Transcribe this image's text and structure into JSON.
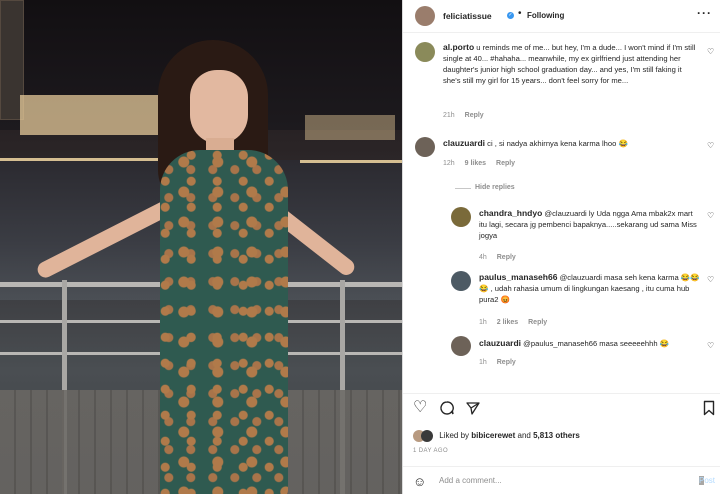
{
  "header": {
    "username": "feliciatissue",
    "following_label": "Following",
    "more_icon": "more-icon"
  },
  "comments": [
    {
      "username": "al.porto",
      "text": "u reminds me of me... but hey, I'm a dude... I won't mind if I'm still single at 40... #hahaha... meanwhile, my ex girlfriend just attending her daughter's junior high school graduation day... and yes, I'm still faking it she's still my girl for 15 years... don't feel sorry for me...",
      "time": "21h",
      "reply_label": "Reply"
    },
    {
      "username": "clauzuardi",
      "text": "ci , si nadya akhirnya kena karma lhoo 😂",
      "time": "12h",
      "likes": "9 likes",
      "reply_label": "Reply",
      "hide_label": "Hide replies"
    }
  ],
  "replies": [
    {
      "username": "chandra_hndyo",
      "text": "@clauzuardi ly Uda ngga Ama mbak2x mart itu lagi, secara jg pembenci bapaknya.....sekarang ud sama Miss jogya",
      "time": "4h",
      "reply_label": "Reply"
    },
    {
      "username": "paulus_manaseh66",
      "text": "@clauzuardi masa seh kena karma 😂😂😂 , udah rahasia umum di lingkungan kaesang , itu cuma hub pura2 😡",
      "time": "1h",
      "likes": "2 likes",
      "reply_label": "Reply"
    },
    {
      "username": "clauzuardi",
      "text": "@paulus_manaseh66 masa seeeeehhh 😂",
      "time": "1h",
      "reply_label": "Reply"
    }
  ],
  "actions": {
    "likes_text_prefix": "Liked by",
    "likes_user": "bibicerewet",
    "likes_and": "and",
    "likes_count": "5,813 others",
    "time_ago": "1 DAY AGO"
  },
  "add_comment": {
    "placeholder": "Add a comment...",
    "post_label": "Post"
  },
  "colors": {
    "link": "#00376b",
    "verified": "#3897f0",
    "muted": "#8e8e8e",
    "post_disabled": "#b3dbff"
  }
}
